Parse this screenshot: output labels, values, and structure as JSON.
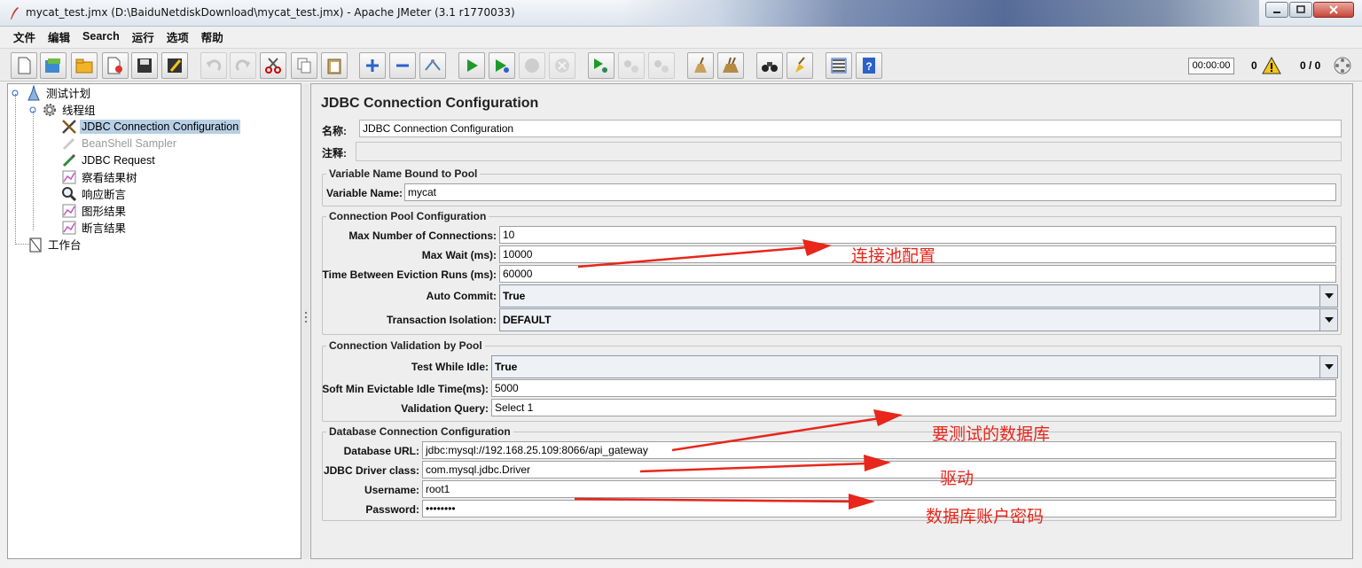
{
  "window": {
    "title": "mycat_test.jmx (D:\\BaiduNetdiskDownload\\mycat_test.jmx) - Apache JMeter (3.1 r1770033)"
  },
  "menu": [
    "文件",
    "编辑",
    "Search",
    "运行",
    "选项",
    "帮助"
  ],
  "toolbar": {
    "timer": "00:00:00",
    "warning_count": "0",
    "threads": "0 / 0",
    "icons": [
      "new-icon",
      "templates-icon",
      "open-icon",
      "close-icon",
      "save-icon",
      "save-as-icon",
      "undo-icon",
      "redo-icon",
      "cut-icon",
      "copy-icon",
      "paste-icon",
      "expand-icon",
      "collapse-icon",
      "toggle-icon",
      "start-icon",
      "start-no-pause-icon",
      "stop-icon",
      "shutdown-icon",
      "remote-start-icon",
      "remote-stop-icon",
      "remote-shutdown-icon",
      "clear-icon",
      "clear-all-icon",
      "search-icon",
      "reset-search-icon",
      "function-helper-icon",
      "help-icon"
    ]
  },
  "tree": {
    "nodes": [
      {
        "label": "测试计划",
        "icon": "test-plan-icon"
      },
      {
        "label": "线程组",
        "icon": "thread-group-icon"
      },
      {
        "label": "JDBC Connection Configuration",
        "icon": "config-element-icon",
        "selected": true
      },
      {
        "label": "BeanShell Sampler",
        "icon": "sampler-icon",
        "disabled": true
      },
      {
        "label": "JDBC Request",
        "icon": "sampler-icon"
      },
      {
        "label": "察看结果树",
        "icon": "listener-icon"
      },
      {
        "label": "响应断言",
        "icon": "assertion-icon"
      },
      {
        "label": "图形结果",
        "icon": "listener-icon"
      },
      {
        "label": "断言结果",
        "icon": "listener-icon"
      },
      {
        "label": "工作台",
        "icon": "workbench-icon"
      }
    ]
  },
  "panel": {
    "title": "JDBC Connection Configuration",
    "name_label": "名称:",
    "name_value": "JDBC Connection Configuration",
    "comment_label": "注释:",
    "comment_value": "",
    "variable_group": {
      "title": "Variable Name Bound to Pool",
      "variable_name_label": "Variable Name:",
      "variable_name_value": "mycat"
    },
    "pool_group": {
      "title": "Connection Pool Configuration",
      "max_connections_label": "Max Number of Connections:",
      "max_connections_value": "10",
      "max_wait_label": "Max Wait (ms):",
      "max_wait_value": "10000",
      "eviction_label": "Time Between Eviction Runs (ms):",
      "eviction_value": "60000",
      "auto_commit_label": "Auto Commit:",
      "auto_commit_value": "True",
      "isolation_label": "Transaction Isolation:",
      "isolation_value": "DEFAULT"
    },
    "validation_group": {
      "title": "Connection Validation by Pool",
      "test_idle_label": "Test While Idle:",
      "test_idle_value": "True",
      "soft_min_label": "Soft Min Evictable Idle Time(ms):",
      "soft_min_value": "5000",
      "query_label": "Validation Query:",
      "query_value": "Select 1"
    },
    "db_group": {
      "title": "Database Connection Configuration",
      "url_label": "Database URL:",
      "url_value": "jdbc:mysql://192.168.25.109:8066/api_gateway",
      "driver_label": "JDBC Driver class:",
      "driver_value": "com.mysql.jdbc.Driver",
      "username_label": "Username:",
      "username_value": "root1",
      "password_label": "Password:",
      "password_value": "••••••••"
    }
  },
  "annotations": {
    "pool": "连接池配置",
    "database": "要测试的数据库",
    "driver": "驱动",
    "account": "数据库账户密码",
    "color": "#e8261b"
  }
}
